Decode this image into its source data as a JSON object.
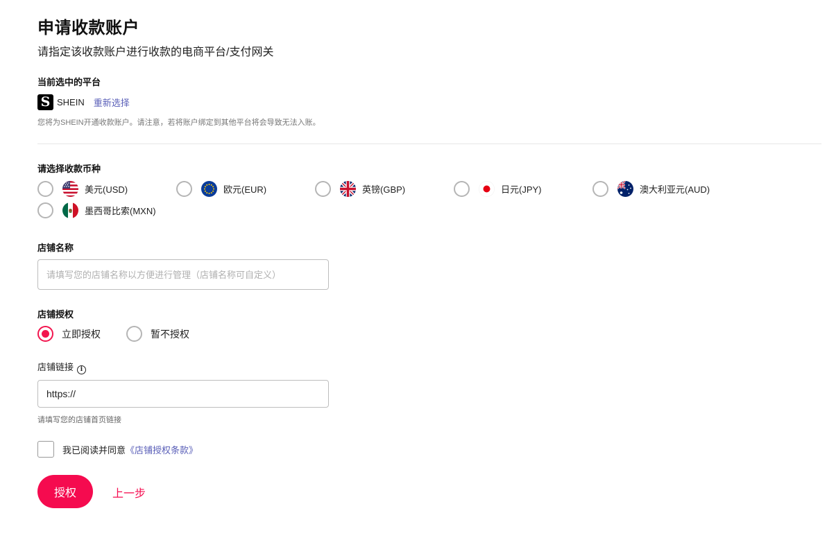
{
  "header": {
    "title": "申请收款账户",
    "subtitle": "请指定该收款账户进行收款的电商平台/支付网关"
  },
  "platform": {
    "section_label": "当前选中的平台",
    "logo_letter": "S",
    "name": "SHEIN",
    "reselect_label": "重新选择",
    "note": "您将为SHEIN开通收款账户。请注意，若将账户绑定到其他平台将会导致无法入账。"
  },
  "currency": {
    "section_label": "请选择收款币种",
    "options": [
      {
        "label": "美元(USD)",
        "icon": "us-flag-icon",
        "selected": false
      },
      {
        "label": "欧元(EUR)",
        "icon": "eu-flag-icon",
        "selected": false
      },
      {
        "label": "英镑(GBP)",
        "icon": "uk-flag-icon",
        "selected": false
      },
      {
        "label": "日元(JPY)",
        "icon": "japan-flag-icon",
        "selected": false
      },
      {
        "label": "澳大利亚元(AUD)",
        "icon": "australia-flag-icon",
        "selected": false
      },
      {
        "label": "墨西哥比索(MXN)",
        "icon": "mexico-flag-icon",
        "selected": false
      }
    ]
  },
  "store_name": {
    "label": "店铺名称",
    "value": "",
    "placeholder": "请填写您的店铺名称以方便进行管理（店铺名称可自定义）"
  },
  "authorization": {
    "label": "店铺授权",
    "options": [
      {
        "label": "立即授权",
        "selected": true
      },
      {
        "label": "暂不授权",
        "selected": false
      }
    ]
  },
  "store_link": {
    "label": "店铺链接",
    "info_glyph": "i",
    "value": "https://",
    "helper": "请填写您的店铺首页链接"
  },
  "agreement": {
    "checked": false,
    "text": "我已阅读并同意",
    "link_text": "《店铺授权条款》"
  },
  "actions": {
    "submit_label": "授权",
    "back_label": "上一步"
  },
  "colors": {
    "accent": "#f50b4f",
    "link": "#5a5fb8"
  }
}
